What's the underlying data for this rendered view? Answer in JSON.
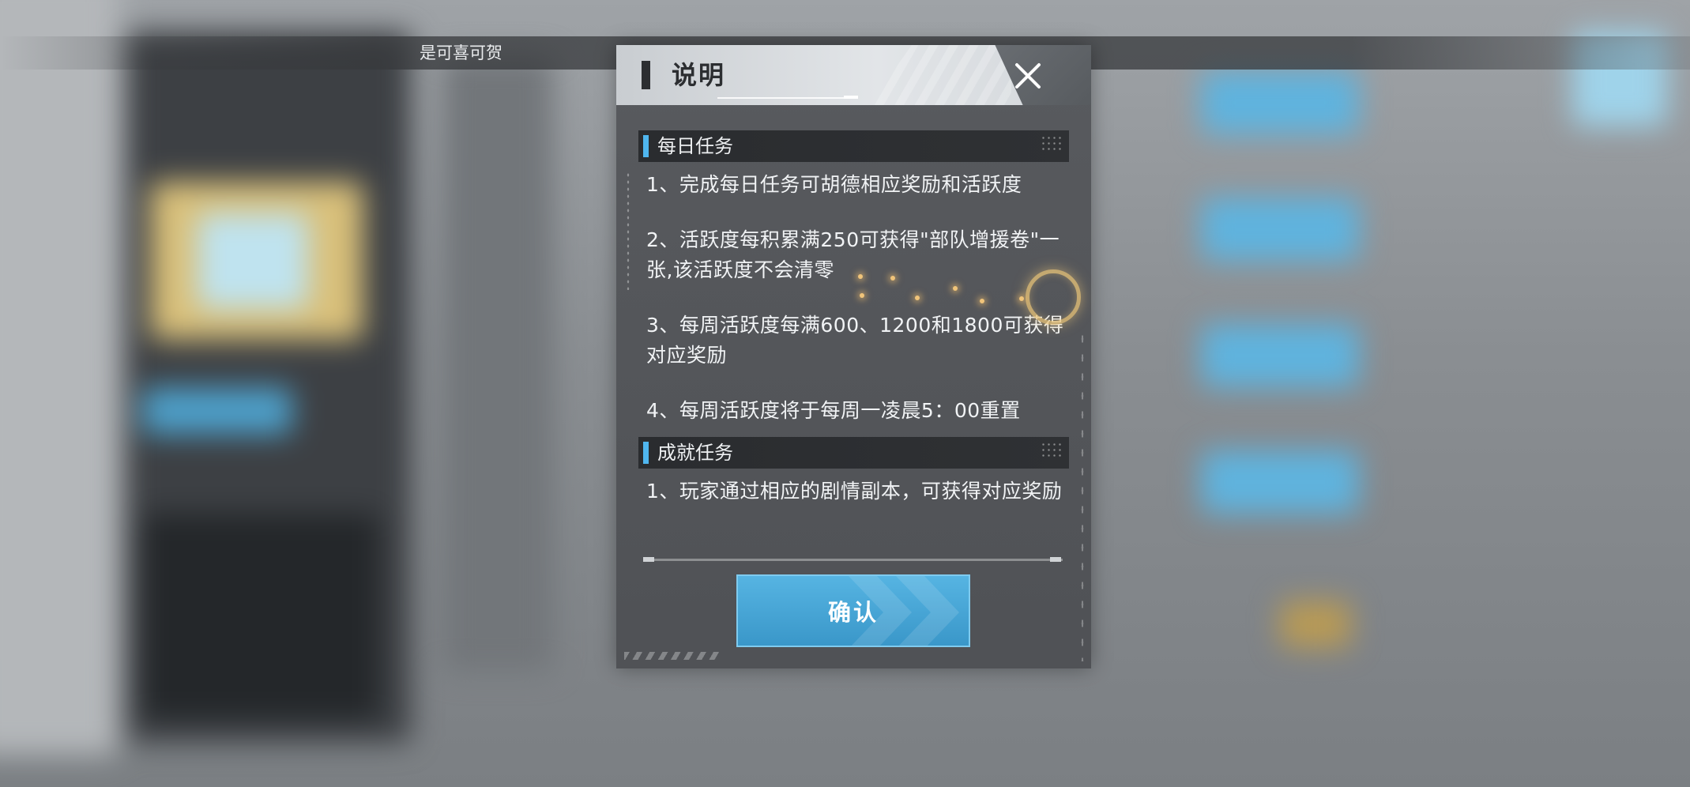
{
  "background": {
    "window_title": "是可喜可贺"
  },
  "dialog": {
    "title": "说明",
    "close_icon": "close-icon",
    "sections": [
      {
        "heading": "每日任务",
        "paragraphs": [
          "1、完成每日任务可胡德相应奖励和活跃度",
          "2、活跃度每积累满250可获得\"部队增援卷\"一张,该活跃度不会清零",
          "3、每周活跃度每满600、1200和1800可获得对应奖励",
          "4、每周活跃度将于每周一凌晨5：00重置"
        ]
      },
      {
        "heading": "成就任务",
        "paragraphs": [
          "1、玩家通过相应的剧情副本，可获得对应奖励"
        ]
      }
    ],
    "confirm_label": "确认"
  },
  "colors": {
    "accent_blue": "#4fb6ef",
    "button_blue": "#4aa8d8",
    "dialog_bg": "#55575b",
    "section_header_bg": "#2c2e31"
  }
}
